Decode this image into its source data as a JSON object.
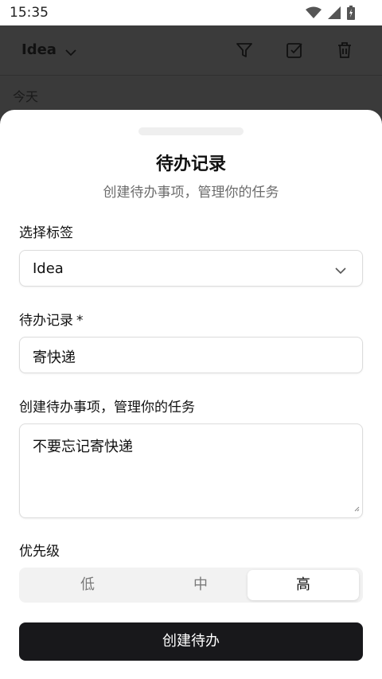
{
  "status_bar": {
    "time": "15:35"
  },
  "app_bar": {
    "title": "Idea"
  },
  "list": {
    "section_header": "今天"
  },
  "sheet": {
    "title": "待办记录",
    "subtitle": "创建待办事项，管理你的任务",
    "tag_select": {
      "label": "选择标签",
      "value": "Idea"
    },
    "todo_input": {
      "label": "待办记录",
      "required_mark": "*",
      "value": "寄快递"
    },
    "description": {
      "label": "创建待办事项，管理你的任务",
      "value": "不要忘记寄快递"
    },
    "priority": {
      "label": "优先级",
      "options": [
        "低",
        "中",
        "高"
      ],
      "selected": "高"
    },
    "submit_label": "创建待办"
  },
  "colors": {
    "primary_button": "#18181b",
    "scrim": "#3b3b3b"
  }
}
